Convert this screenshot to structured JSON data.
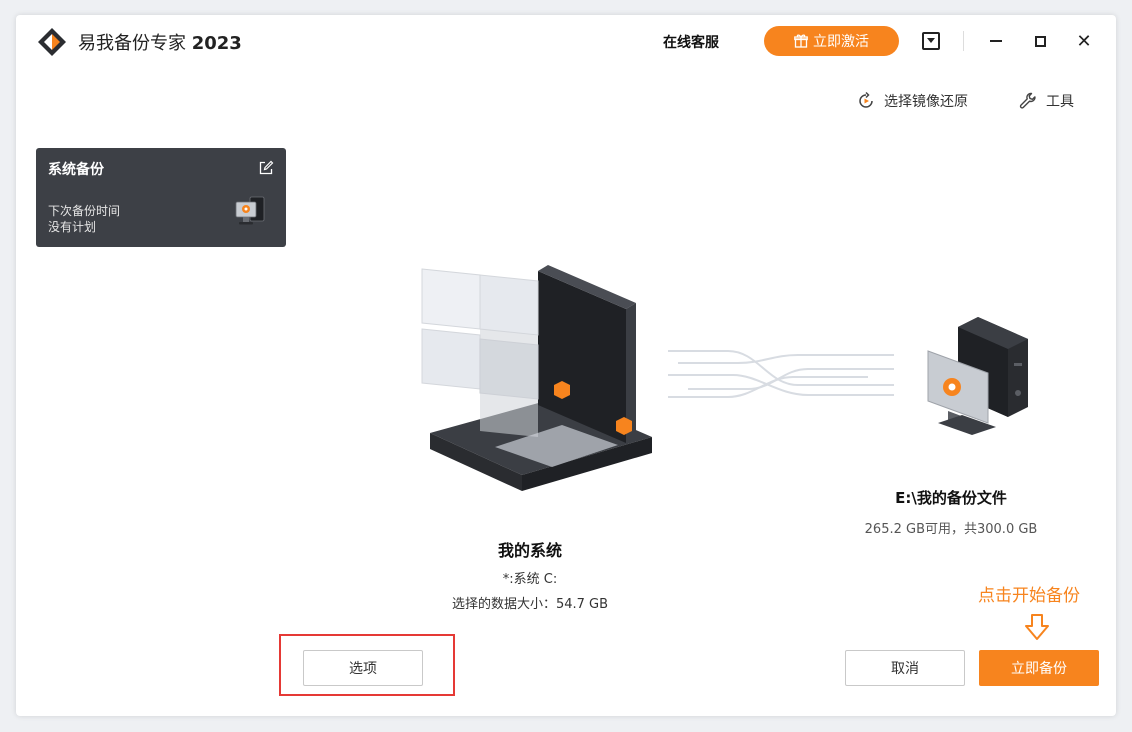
{
  "app": {
    "title": "易我备份专家",
    "version": "2023"
  },
  "header": {
    "service": "在线客服",
    "activate": "立即激活"
  },
  "top_actions": {
    "restore_image": "选择镜像还原",
    "tools": "工具"
  },
  "backup_card": {
    "title": "系统备份",
    "next_time_label": "下次备份时间",
    "plan": "没有计划"
  },
  "source": {
    "name": "我的系统",
    "partition": "*:系统 C:",
    "size": "选择的数据大小：54.7 GB"
  },
  "target": {
    "name": "E:\\我的备份文件",
    "space": "265.2 GB可用，共300.0 GB"
  },
  "hint": "点击开始备份",
  "buttons": {
    "options": "选项",
    "cancel": "取消",
    "backup": "立即备份"
  },
  "colors": {
    "accent": "#f7841e",
    "card_bg": "#3d4046",
    "highlight": "#e53935"
  }
}
